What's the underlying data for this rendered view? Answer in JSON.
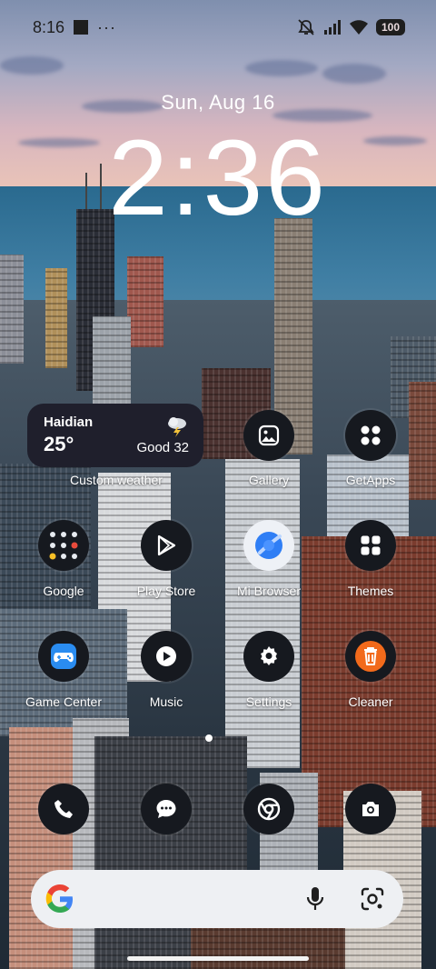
{
  "status_bar": {
    "time": "8:16",
    "dots": "···",
    "battery": "100"
  },
  "lock": {
    "date": "Sun, Aug 16",
    "time": "2:36"
  },
  "weather_widget": {
    "city": "Haidian",
    "temperature": "25°",
    "air_quality": "Good 32",
    "label": "Custom weather"
  },
  "apps": [
    {
      "name": "Gallery",
      "icon": "gallery-icon"
    },
    {
      "name": "GetApps",
      "icon": "grid-icon"
    },
    {
      "name": "Google",
      "icon": "folder-icon"
    },
    {
      "name": "Play Store",
      "icon": "play-store-icon"
    },
    {
      "name": "Mi Browser",
      "icon": "browser-icon"
    },
    {
      "name": "Themes",
      "icon": "grid-icon"
    },
    {
      "name": "Game Center",
      "icon": "gamepad-icon"
    },
    {
      "name": "Music",
      "icon": "play-circle-icon"
    },
    {
      "name": "Settings",
      "icon": "gear-icon"
    },
    {
      "name": "Cleaner",
      "icon": "trash-icon"
    }
  ],
  "dock": [
    {
      "icon": "phone-icon"
    },
    {
      "icon": "messages-icon"
    },
    {
      "icon": "chrome-icon"
    },
    {
      "icon": "camera-icon"
    }
  ],
  "search_bar": {
    "logo_icon": "google-g-icon",
    "mic_icon": "mic-icon",
    "lens_icon": "lens-icon"
  },
  "colors": {
    "icon_bg": "#16191f",
    "widget_bg": "#1f1f2c",
    "cleaner_accent": "#f26a1b",
    "browser_accent": "#2f7ef5",
    "gamecenter_accent": "#2a8cf0"
  }
}
